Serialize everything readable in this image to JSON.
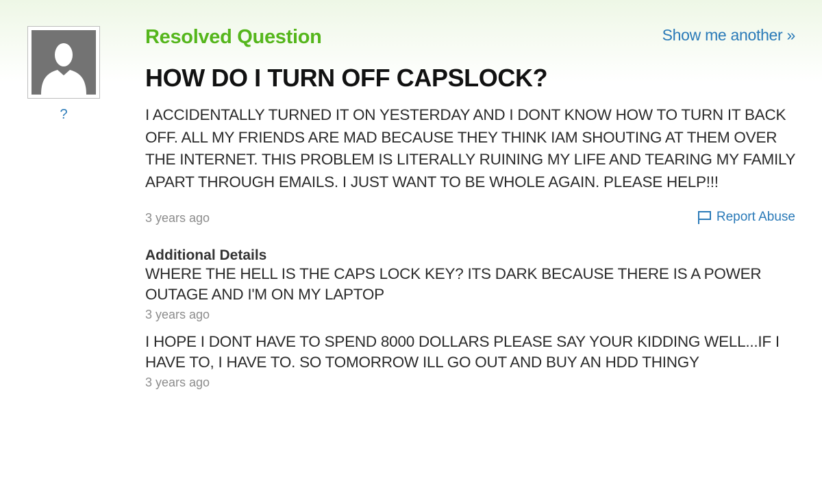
{
  "asker": {
    "avatar_icon": "user-silhouette-icon",
    "name": "?"
  },
  "question": {
    "status": "Resolved Question",
    "show_another": "Show me another »",
    "title": "HOW DO I TURN OFF CAPSLOCK?",
    "body": "I ACCIDENTALLY TURNED IT ON YESTERDAY AND I DONT KNOW HOW TO TURN IT BACK OFF. ALL MY FRIENDS ARE MAD BECAUSE THEY THINK IAM SHOUTING AT THEM OVER THE INTERNET. THIS PROBLEM IS LITERALLY RUINING MY LIFE AND TEARING MY FAMILY APART THROUGH EMAILS. I JUST WANT TO BE WHOLE AGAIN. PLEASE HELP!!!",
    "timestamp": "3 years ago",
    "report_abuse": "Report Abuse",
    "report_icon": "flag-icon"
  },
  "additional_details": {
    "heading": "Additional Details",
    "items": [
      {
        "text": "WHERE THE HELL IS THE CAPS LOCK KEY? ITS DARK BECAUSE THERE IS A POWER OUTAGE AND I'M ON MY LAPTOP",
        "timestamp": "3 years ago"
      },
      {
        "text": "I HOPE I DONT HAVE TO SPEND 8000 DOLLARS PLEASE SAY YOUR KIDDING WELL...IF I HAVE TO, I HAVE TO. SO TOMORROW ILL GO OUT AND BUY AN HDD THINGY",
        "timestamp": "3 years ago"
      }
    ]
  },
  "colors": {
    "status_green": "#55b61c",
    "link_blue": "#2a7ab8",
    "timestamp_gray": "#8c8c8c",
    "avatar_gray": "#737373"
  }
}
